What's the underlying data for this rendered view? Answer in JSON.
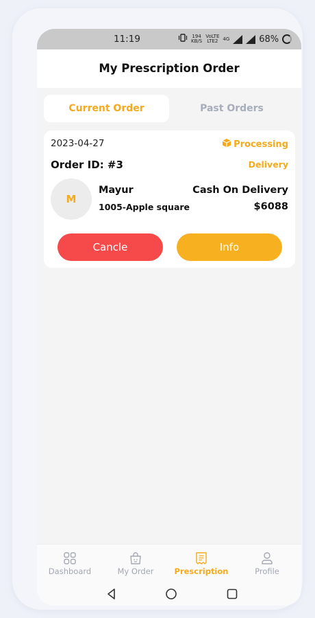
{
  "status_bar": {
    "time": "11:19",
    "speed_top": "194",
    "speed_unit": "KB/S",
    "net_top": "VoLTE",
    "net_bottom": "LTE2",
    "network_type": "4G",
    "battery": "68%"
  },
  "header": {
    "title": "My Prescription Order"
  },
  "tabs": [
    {
      "label": "Current Order",
      "active": true
    },
    {
      "label": "Past Orders",
      "active": false
    }
  ],
  "order": {
    "date": "2023-04-27",
    "status": "Processing",
    "status_icon": "package-icon",
    "order_id": "Order ID: #3",
    "delivery_type": "Delivery",
    "avatar_initial": "M",
    "customer_name": "Mayur",
    "address": "1005-Apple square",
    "payment_method": "Cash On Delivery",
    "amount": "$6088",
    "cancel_label": "Cancle",
    "info_label": "Info"
  },
  "bottom_nav": [
    {
      "label": "Dashboard",
      "icon": "grid-icon",
      "active": false
    },
    {
      "label": "My Order",
      "icon": "bag-icon",
      "active": false
    },
    {
      "label": "Prescription",
      "icon": "receipt-icon",
      "active": true
    },
    {
      "label": "Profile",
      "icon": "user-icon",
      "active": false
    }
  ],
  "colors": {
    "accent": "#f5aa1c",
    "cancel": "#f64a4a",
    "info": "#f7b020",
    "inactive": "#a3a7b3"
  }
}
